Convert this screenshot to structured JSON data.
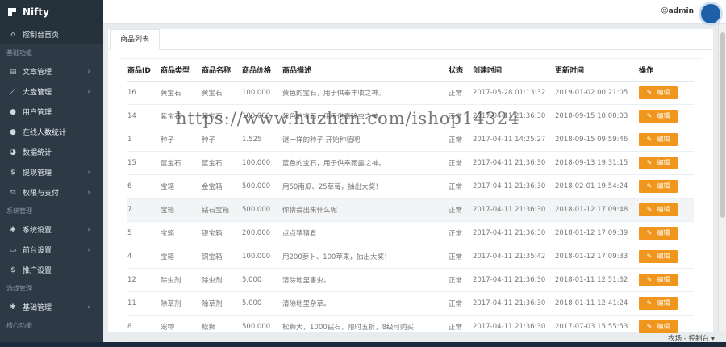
{
  "brand": {
    "name": "Nifty"
  },
  "sidebar": {
    "dashboard": {
      "label": "控制台首页",
      "icon": "home-icon"
    },
    "sections": [
      {
        "title": "基础功能",
        "items": [
          {
            "label": "文章管理",
            "icon": "document-icon",
            "arrow": "›"
          },
          {
            "label": "大盘管理",
            "icon": "chart-icon",
            "arrow": "›"
          },
          {
            "label": "用户管理",
            "icon": "user-circle-icon",
            "arrow": ""
          },
          {
            "label": "在线人数统计",
            "icon": "user-circle-icon",
            "arrow": ""
          },
          {
            "label": "数据统计",
            "icon": "pie-icon",
            "arrow": ""
          },
          {
            "label": "提现管理",
            "icon": "dollar-icon",
            "arrow": "›"
          },
          {
            "label": "权限与支付",
            "icon": "balance-icon",
            "arrow": "›"
          }
        ]
      },
      {
        "title": "系统管理",
        "items": [
          {
            "label": "系统设置",
            "icon": "gear-icon",
            "arrow": "›"
          },
          {
            "label": "前台设置",
            "icon": "monitor-icon",
            "arrow": "›"
          },
          {
            "label": "推广设置",
            "icon": "dollar-icon",
            "arrow": ""
          }
        ]
      },
      {
        "title": "游戏管理",
        "items": [
          {
            "label": "基础管理",
            "icon": "gear-icon",
            "arrow": "›"
          }
        ]
      },
      {
        "title": "核心功能",
        "items": []
      }
    ]
  },
  "topbar": {
    "user": "admin"
  },
  "tabs": [
    {
      "label": "商品列表"
    }
  ],
  "table": {
    "headers": [
      "商品ID",
      "商品类型",
      "商品名称",
      "商品价格",
      "商品描述",
      "状态",
      "创建时间",
      "更新时间",
      "操作"
    ],
    "edit_label": "编辑",
    "rows": [
      [
        "16",
        "黄宝石",
        "黄宝石",
        "100.000",
        "黄色的宝石，用于供奉丰收之神。",
        "正常",
        "2017-05-28 01:13:32",
        "2019-01-02 00:21:05"
      ],
      [
        "14",
        "紫宝石",
        "紫宝石",
        "100.000",
        "紫色的宝石，用于供奉除虫之神。",
        "正常",
        "2017-04-11 21:36:30",
        "2018-09-15 10:00:03"
      ],
      [
        "1",
        "种子",
        "种子",
        "1.525",
        "谜一样的种子 开始种植吧",
        "正常",
        "2017-04-11 14:25:27",
        "2018-09-15 09:59:46"
      ],
      [
        "15",
        "蓝宝石",
        "蓝宝石",
        "100.000",
        "蓝色的宝石，用于供奉雨露之神。",
        "正常",
        "2017-04-11 21:36:30",
        "2018-09-13 19:31:15"
      ],
      [
        "6",
        "宝箱",
        "金宝箱",
        "500.000",
        "用50南瓜、25草莓，抽出大奖！",
        "正常",
        "2017-04-11 21:36:30",
        "2018-02-01 19:54:24"
      ],
      [
        "7",
        "宝箱",
        "钻石宝箱",
        "500.000",
        "你猜会出来什么呢",
        "正常",
        "2017-04-11 21:36:30",
        "2018-01-12 17:09:48"
      ],
      [
        "5",
        "宝箱",
        "银宝箱",
        "200.000",
        "点点猜猜看",
        "正常",
        "2017-04-11 21:36:30",
        "2018-01-12 17:09:39"
      ],
      [
        "4",
        "宝箱",
        "铜宝箱",
        "100.000",
        "用200萝卜、100苹果，抽出大奖！",
        "正常",
        "2017-04-11 21:35:42",
        "2018-01-12 17:09:33"
      ],
      [
        "12",
        "除虫剂",
        "除虫剂",
        "5.000",
        "清除地里害虫。",
        "正常",
        "2017-04-11 21:36:30",
        "2018-01-11 12:51:32"
      ],
      [
        "11",
        "除草剂",
        "除草剂",
        "5.000",
        "清除地里杂草。",
        "正常",
        "2017-04-11 21:36:30",
        "2018-01-11 12:41:24"
      ],
      [
        "8",
        "宠物",
        "松狮",
        "500.000",
        "松狮犬，1000钻石，限时五折，8级可购买",
        "正常",
        "2017-04-11 21:36:30",
        "2017-07-03 15:55:53"
      ]
    ]
  },
  "footer": {
    "link": "农场 - 控制台 ▾"
  },
  "watermark": "https://www.huzhan.com/ishop14324",
  "colors": {
    "sidebar": "#2d3a46",
    "edit_button": "#f0961c",
    "avatar": "#1f5fa8"
  }
}
